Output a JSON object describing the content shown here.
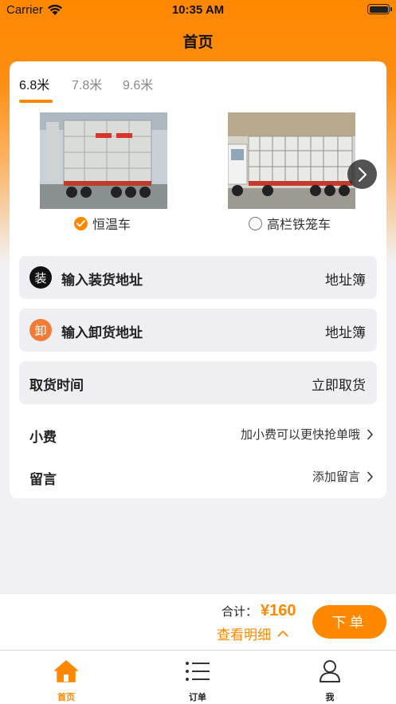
{
  "status_bar": {
    "carrier": "Carrier",
    "time": "10:35 AM"
  },
  "nav": {
    "title": "首页"
  },
  "tabs": [
    {
      "label": "6.8米",
      "active": true
    },
    {
      "label": "7.8米",
      "active": false
    },
    {
      "label": "9.6米",
      "active": false
    }
  ],
  "trucks": [
    {
      "label": "恒温车",
      "selected": true
    },
    {
      "label": "高栏铁笼车",
      "selected": false
    }
  ],
  "address": {
    "load": {
      "badge": "装",
      "placeholder": "输入装货地址",
      "book": "地址簿"
    },
    "unload": {
      "badge": "卸",
      "placeholder": "输入卸货地址",
      "book": "地址簿"
    }
  },
  "pickup": {
    "label": "取货时间",
    "value": "立即取货"
  },
  "tip": {
    "label": "小费",
    "hint": "加小费可以更快抢单哦"
  },
  "message": {
    "label": "留言",
    "hint": "添加留言"
  },
  "bottom": {
    "total_label": "合计：",
    "total_amount": "¥160",
    "details": "查看明细",
    "order_button": "下单"
  },
  "tabbar": [
    {
      "label": "首页",
      "icon": "home-icon",
      "active": true
    },
    {
      "label": "订单",
      "icon": "list-icon",
      "active": false
    },
    {
      "label": "我",
      "icon": "user-icon",
      "active": false
    }
  ],
  "colors": {
    "accent": "#ff8800",
    "unload_badge": "#f37b36",
    "row_bg": "#efeff3"
  }
}
